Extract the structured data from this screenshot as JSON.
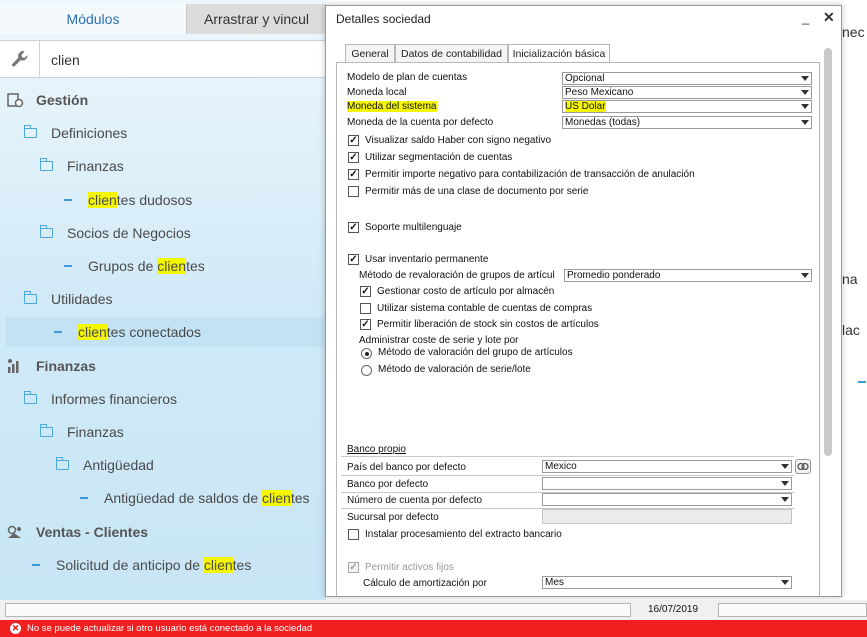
{
  "left_panel": {
    "tabs": [
      "Módulos",
      "Arrastrar y vincul"
    ],
    "search_value": "clien",
    "tree": [
      {
        "pre": "",
        "hl": "",
        "post": "Gestión",
        "kind": "module",
        "icon": "gestion-icon",
        "indent": 0
      },
      {
        "pre": "Definiciones",
        "hl": "",
        "post": "",
        "kind": "folder",
        "indent": 1
      },
      {
        "pre": "Finanzas",
        "hl": "",
        "post": "",
        "kind": "folder",
        "indent": 2
      },
      {
        "pre": "",
        "hl": "clien",
        "post": "tes dudosos",
        "kind": "item",
        "indent": 3
      },
      {
        "pre": "Socios de Negocios",
        "hl": "",
        "post": "",
        "kind": "folder",
        "indent": 2
      },
      {
        "pre": "Grupos de ",
        "hl": "clien",
        "post": "tes",
        "kind": "item",
        "indent": 3
      },
      {
        "pre": "Utilidades",
        "hl": "",
        "post": "",
        "kind": "folder",
        "indent": 1
      },
      {
        "pre": "",
        "hl": "clien",
        "post": "tes conectados",
        "kind": "item",
        "indent": 2,
        "selected": true
      },
      {
        "pre": "",
        "hl": "",
        "post": "Finanzas",
        "kind": "module",
        "icon": "finanzas-icon",
        "indent": 0
      },
      {
        "pre": "Informes financieros",
        "hl": "",
        "post": "",
        "kind": "folder",
        "indent": 1
      },
      {
        "pre": "Finanzas",
        "hl": "",
        "post": "",
        "kind": "folder",
        "indent": 2
      },
      {
        "pre": "Antigüedad",
        "hl": "",
        "post": "",
        "kind": "folder",
        "indent": 3
      },
      {
        "pre": "Antigüedad de saldos de ",
        "hl": "clien",
        "post": "tes",
        "kind": "item",
        "indent": 4
      },
      {
        "pre": "",
        "hl": "",
        "post": "Ventas - Clientes",
        "kind": "module",
        "icon": "ventas-icon",
        "indent": 0
      },
      {
        "pre": "Solicitud de anticipo de ",
        "hl": "clien",
        "post": "tes",
        "kind": "item",
        "indent": 1
      }
    ]
  },
  "background_fragments": [
    "nec",
    "na",
    "lac"
  ],
  "dialog": {
    "title": "Detalles sociedad",
    "minimize": "_",
    "close": "✕",
    "tabs": [
      "General",
      "Datos de contabilidad",
      "Inicialización básica"
    ],
    "fields": {
      "modelo_label": "Modelo de plan de cuentas",
      "modelo_value": "Opcional",
      "moneda_local_label": "Moneda local",
      "moneda_local_value": "Peso Mexicano",
      "moneda_sistema_label": "Moneda del sistema",
      "moneda_sistema_value": "US Dolar",
      "moneda_cuenta_label": "Moneda de la cuenta por defecto",
      "moneda_cuenta_value": "Monedas (todas)"
    },
    "checks": {
      "visualizar": "Visualizar saldo Haber con signo negativo",
      "segmentacion": "Utilizar segmentación de cuentas",
      "importe_negativo": "Permitir importe negativo para contabilización de transacción de anulación",
      "mas_clase": "Permitir más de una clase de documento por serie",
      "multilenguaje": "Soporte multilenguaje",
      "inventario": "Usar inventario permanente",
      "gestionar_costo": "Gestionar costo de artículo por almacén",
      "sistema_compras": "Utilizar sistema contable de cuentas de compras",
      "liberacion_stock": "Permitir liberación de stock sin costos de artículos",
      "instalar_extracto": "Instalar procesamiento del extracto bancario",
      "activos_fijos": "Permitir activos fijos"
    },
    "check_mark": "✓",
    "revaloracion_label": "Método de revaloración de grupos de artícul",
    "revaloracion_value": "Promedio ponderado",
    "administrar_label": "Administrar coste de serie y lote por",
    "radio_grupo": "Método de valoración del grupo de artículos",
    "radio_serie": "Método de valoración de serie/lote",
    "banco": {
      "section_title": "Banco propio",
      "pais_label": "País del banco por defecto",
      "pais_value": "Mexico",
      "banco_label": "Banco por defecto",
      "banco_value": "",
      "cuenta_label": "Número de cuenta por defecto",
      "cuenta_value": "",
      "sucursal_label": "Sucursal por defecto",
      "sucursal_value": ""
    },
    "amortizacion_label": "Cálculo de amortización por",
    "amortizacion_value": "Mes"
  },
  "statusbar": {
    "date": "16/07/2019"
  },
  "error": {
    "icon": "✕",
    "text": "No se puede actualizar si otro usuario está conectado a la sociedad"
  },
  "colors": {
    "highlight": "#f5f700",
    "error_bar": "#f02020",
    "accent": "#2a6fb6"
  }
}
